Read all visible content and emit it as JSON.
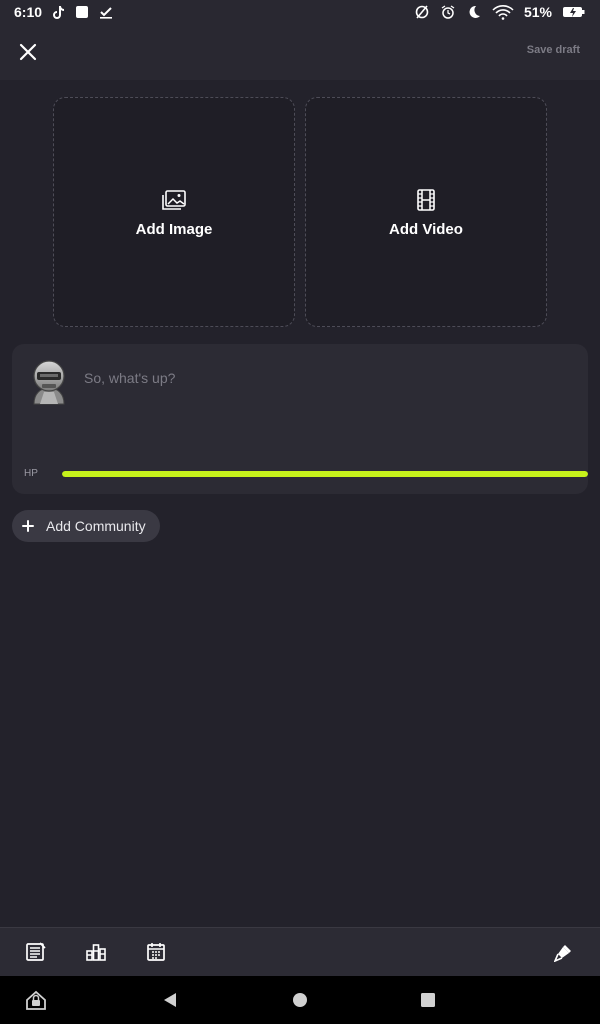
{
  "status_bar": {
    "time": "6:10",
    "battery": "51%",
    "left_icons": [
      "tiktok-icon",
      "square-notification-icon",
      "task-check-icon"
    ],
    "right_icons": [
      "no-sync-icon",
      "alarm-icon",
      "moon-icon",
      "wifi-icon",
      "battery-charging-icon"
    ]
  },
  "header": {
    "close_icon": "close-icon",
    "save_draft_label": "Save draft"
  },
  "media": {
    "image_label": "Add Image",
    "image_icon": "image-icon",
    "video_label": "Add Video",
    "video_icon": "film-icon"
  },
  "composer": {
    "placeholder": "So, what's up?",
    "hp_label": "HP",
    "hp_fraction": 1.0,
    "hp_color": "#c6f21b"
  },
  "community": {
    "label": "Add Community",
    "icon": "plus-icon"
  },
  "toolbar": {
    "icons": [
      "post-list-icon",
      "bar-chart-icon",
      "calendar-icon",
      "pen-icon"
    ]
  },
  "nav_bar": {
    "icons": [
      "lock-home-icon",
      "back-icon",
      "home-icon",
      "recents-icon"
    ]
  },
  "colors": {
    "background": "#23222b",
    "card": "#2c2b34",
    "accent": "#c6f21b"
  }
}
